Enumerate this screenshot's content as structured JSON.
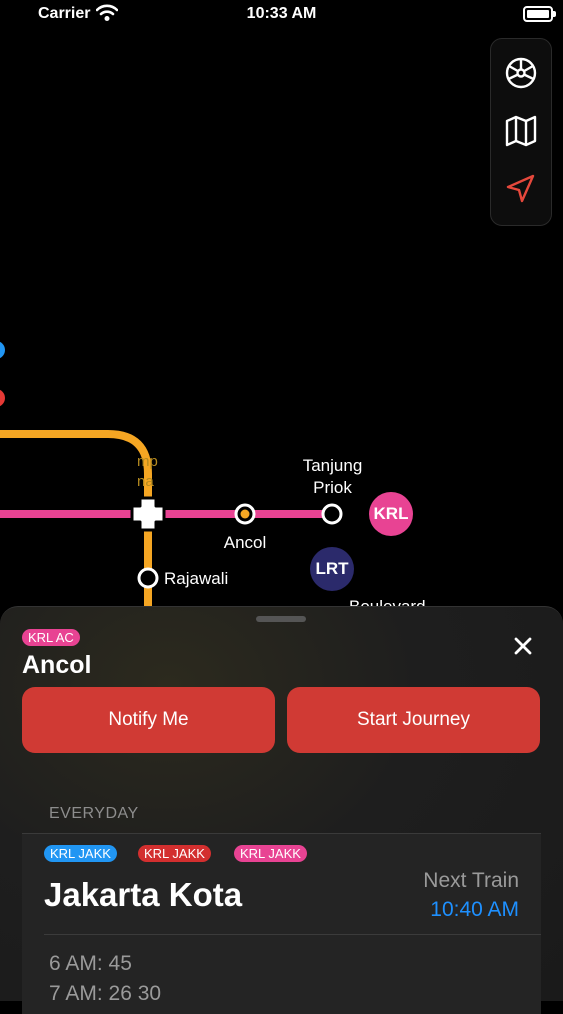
{
  "status_bar": {
    "carrier": "Carrier",
    "time": "10:33 AM"
  },
  "map": {
    "stations": {
      "tanjung_priok": "Tanjung\nPriok",
      "ancol": "Ancol",
      "rajawali": "Rajawali",
      "boulevard": "Boulevard"
    },
    "badges": {
      "krl": "KRL",
      "lrt": "LRT"
    },
    "colors": {
      "pink_line": "#e84393",
      "yellow_line": "#f5a623",
      "orange_station": "#f5a623",
      "krl_badge": "#e84393",
      "lrt_badge": "#2b2a6b"
    }
  },
  "map_controls": {
    "icons": [
      "steering-wheel-icon",
      "map-icon",
      "location-arrow-icon"
    ],
    "accent": "#e5483c"
  },
  "sheet": {
    "line_tag": "KRL AC",
    "station": "Ancol",
    "buttons": {
      "notify": "Notify Me",
      "start": "Start Journey"
    },
    "section": "EVERYDAY",
    "card": {
      "tags": [
        {
          "label": "KRL JAKK",
          "color": "#2196f3"
        },
        {
          "label": "KRL JAKK",
          "color": "#d32f2f"
        },
        {
          "label": "KRL JAKK",
          "color": "#e84393"
        }
      ],
      "destination": "Jakarta Kota",
      "next_train_label": "Next Train",
      "next_train_time": "10:40 AM",
      "schedule": [
        "6 AM: 45",
        "7 AM: 26 30"
      ]
    }
  }
}
